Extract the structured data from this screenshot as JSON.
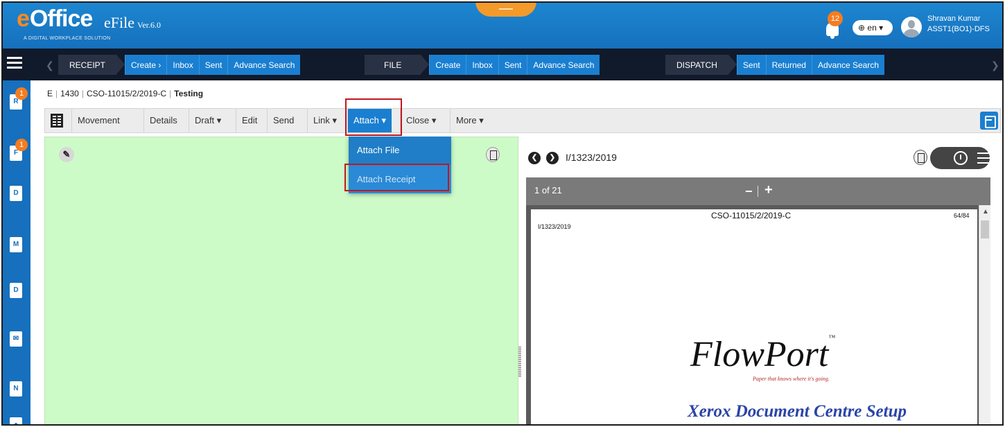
{
  "header": {
    "logo_e": "e",
    "logo_office": "Office",
    "logo_tagline": "A DIGITAL WORKPLACE SOLUTION",
    "app_name": "eFile",
    "version": "Ver.6.0",
    "notification_count": "12",
    "language": "en",
    "user_name": "Shravan Kumar",
    "user_role": "ASST1(BO1)-DFS"
  },
  "nav": {
    "receipt": {
      "label": "RECEIPT",
      "items": [
        "Create ›",
        "Inbox",
        "Sent",
        "Advance Search"
      ]
    },
    "file": {
      "label": "FILE",
      "items": [
        "Create",
        "Inbox",
        "Sent",
        "Advance Search"
      ]
    },
    "dispatch": {
      "label": "DISPATCH",
      "items": [
        "Sent",
        "Returned",
        "Advance Search"
      ]
    }
  },
  "sidebar": {
    "items": [
      {
        "icon": "receipt-icon",
        "text": "R",
        "badge": "1"
      },
      {
        "icon": "file-icon",
        "text": "F",
        "badge": "1"
      },
      {
        "icon": "dispatch-icon",
        "text": "D"
      },
      {
        "icon": "movement-icon",
        "text": "M"
      },
      {
        "icon": "dashboard-icon",
        "text": "D"
      },
      {
        "icon": "envelope-icon",
        "text": "✉"
      },
      {
        "icon": "notice-icon",
        "text": "N"
      },
      {
        "icon": "user-icon",
        "text": "●"
      }
    ]
  },
  "breadcrumb": {
    "type": "E",
    "number": "1430",
    "file_no": "CSO-11015/2/2019-C",
    "subject": "Testing"
  },
  "toolbar": {
    "movement": "Movement",
    "details": "Details",
    "draft": "Draft ▾",
    "edit": "Edit",
    "send": "Send",
    "link": "Link ▾",
    "attach": "Attach ▾",
    "close": "Close ▾",
    "more": "More ▾"
  },
  "attach_menu": {
    "attach_file": "Attach File",
    "attach_receipt": "Attach Receipt"
  },
  "viewer": {
    "doc_id": "I/1323/2019",
    "page_indicator": "1 of 21",
    "zoom_out": "−",
    "zoom_in": "+",
    "page_title": "CSO-11015/2/2019-C",
    "page_number": "64/84",
    "page_ref": "I/1323/2019",
    "brand": "FlowPort",
    "brand_tm": "™",
    "brand_tagline": "Paper that knows where it's going.",
    "heading": "Xerox Document Centre Setup"
  }
}
